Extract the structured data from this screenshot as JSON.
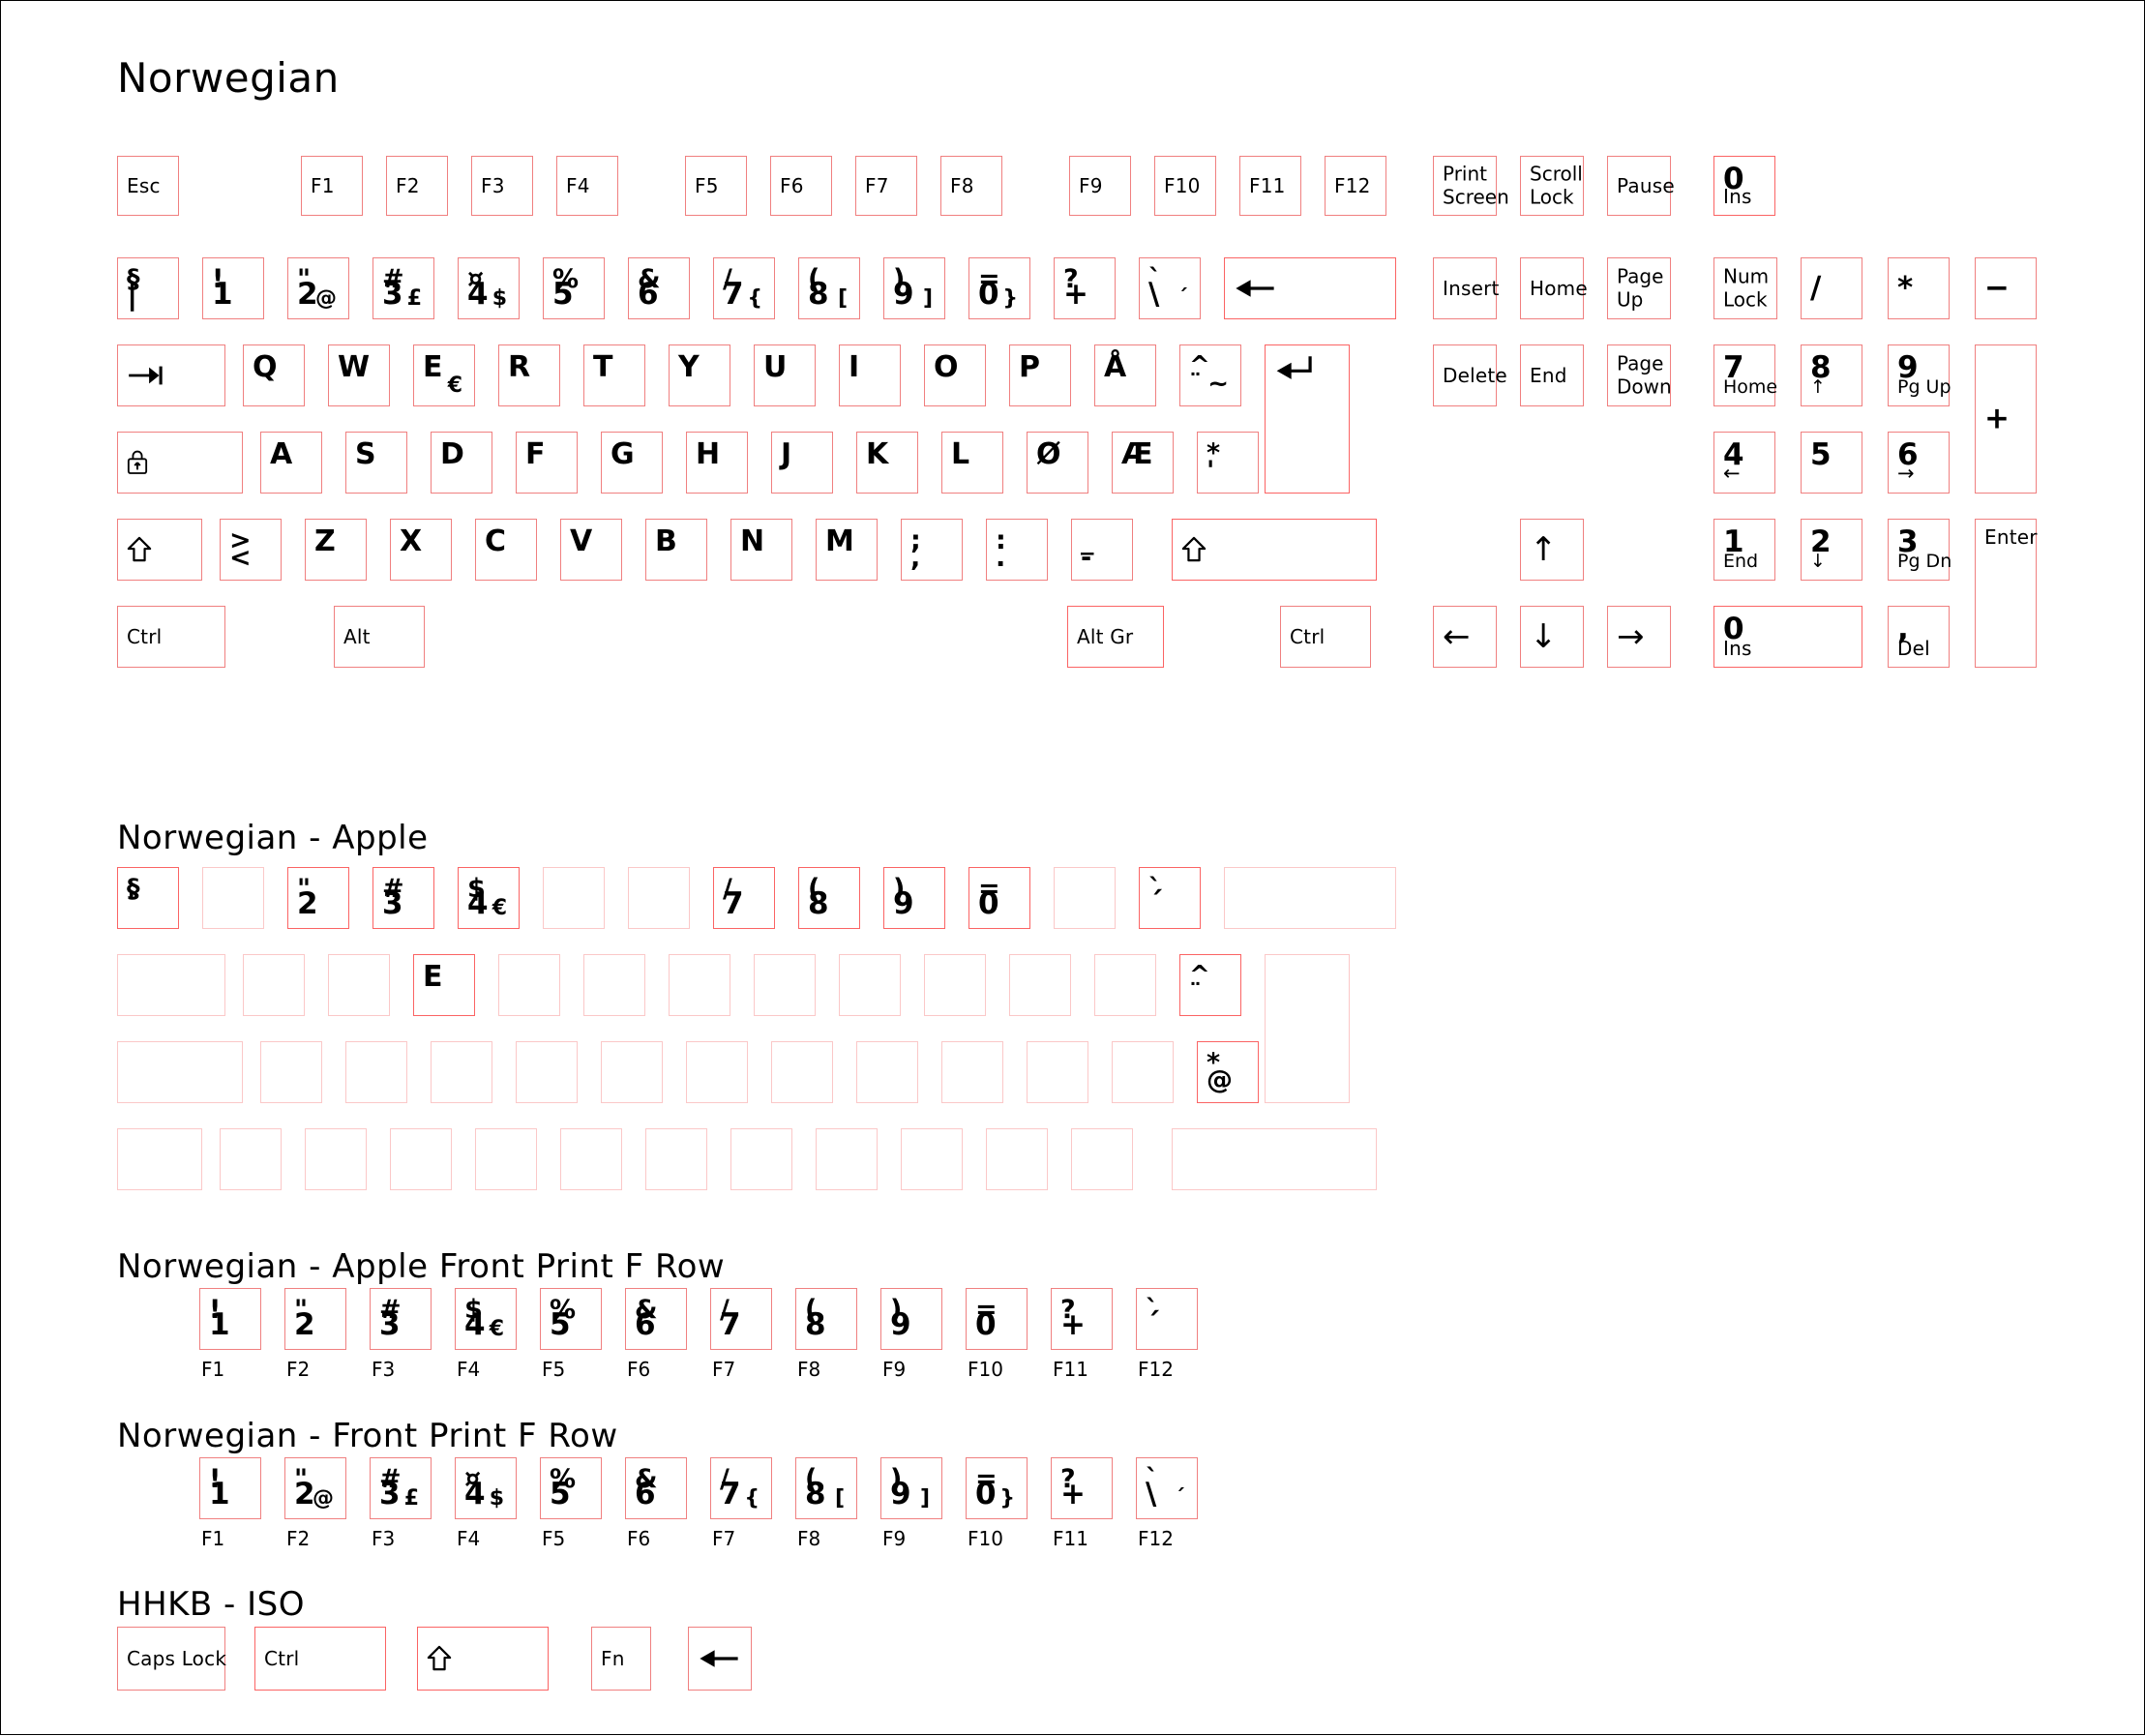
{
  "page": {
    "title": "Norwegian",
    "accent_color": "#f08080",
    "accent_strong": "#fb6464",
    "accent_faint": "#fbc8c8",
    "background": "#ffffff",
    "text_color": "#000000"
  },
  "sections": [
    {
      "id": "main",
      "title": "Norwegian"
    },
    {
      "id": "apple",
      "title": "Norwegian - Apple"
    },
    {
      "id": "apple_fp",
      "title": "Norwegian - Apple Front Print F Row"
    },
    {
      "id": "front_print",
      "title": "Norwegian - Front Print F Row"
    },
    {
      "id": "hhkb",
      "title": "HHKB - ISO"
    }
  ],
  "main": {
    "fn_row": [
      {
        "name": "esc",
        "label": "Esc"
      },
      {
        "name": "f1",
        "label": "F1"
      },
      {
        "name": "f2",
        "label": "F2"
      },
      {
        "name": "f3",
        "label": "F3"
      },
      {
        "name": "f4",
        "label": "F4"
      },
      {
        "name": "f5",
        "label": "F5"
      },
      {
        "name": "f6",
        "label": "F6"
      },
      {
        "name": "f7",
        "label": "F7"
      },
      {
        "name": "f8",
        "label": "F8"
      },
      {
        "name": "f9",
        "label": "F9"
      },
      {
        "name": "f10",
        "label": "F10"
      },
      {
        "name": "f11",
        "label": "F11"
      },
      {
        "name": "f12",
        "label": "F12"
      }
    ],
    "sys_row": [
      {
        "name": "print-screen",
        "line1": "Print",
        "line2": "Screen"
      },
      {
        "name": "scroll-lock",
        "line1": "Scroll",
        "line2": "Lock"
      },
      {
        "name": "pause",
        "line1": "Pause",
        "line2": ""
      },
      {
        "name": "numpad-0-ins-top",
        "top": "0",
        "bottom": "Ins"
      }
    ],
    "number_row": [
      {
        "name": "section-key",
        "tl": "§",
        "bl": "|",
        "br": ""
      },
      {
        "name": "key-1",
        "tl": "!",
        "bl": "1",
        "br": ""
      },
      {
        "name": "key-2",
        "tl": "\"",
        "bl": "2",
        "br": "@"
      },
      {
        "name": "key-3",
        "tl": "#",
        "bl": "3",
        "br": "£"
      },
      {
        "name": "key-4",
        "tl": "¤",
        "bl": "4",
        "br": "$"
      },
      {
        "name": "key-5",
        "tl": "%",
        "bl": "5",
        "br": ""
      },
      {
        "name": "key-6",
        "tl": "&",
        "bl": "6",
        "br": ""
      },
      {
        "name": "key-7",
        "tl": "/",
        "bl": "7",
        "br": "{"
      },
      {
        "name": "key-8",
        "tl": "(",
        "bl": "8",
        "br": "["
      },
      {
        "name": "key-9",
        "tl": ")",
        "bl": "9",
        "br": "]"
      },
      {
        "name": "key-0",
        "tl": "=",
        "bl": "0",
        "br": "}"
      },
      {
        "name": "key-plus",
        "tl": "?",
        "bl": "+",
        "br": ""
      },
      {
        "name": "key-backslash",
        "tl": "`",
        "bl": "\\",
        "br": "´"
      },
      {
        "name": "backspace",
        "icon": "←"
      }
    ],
    "nav_row_1": [
      {
        "name": "insert",
        "label": "Insert"
      },
      {
        "name": "home",
        "label": "Home"
      },
      {
        "name": "page-up",
        "line1": "Page",
        "line2": "Up"
      }
    ],
    "numpad_row_1": [
      {
        "name": "num-lock",
        "line1": "Num",
        "line2": "Lock"
      },
      {
        "name": "numpad-divide",
        "label": "/"
      },
      {
        "name": "numpad-multiply",
        "label": "*"
      },
      {
        "name": "numpad-minus",
        "label": "−"
      }
    ],
    "q_row": [
      {
        "name": "tab",
        "icon": "⇥"
      },
      {
        "name": "key-q",
        "label": "Q"
      },
      {
        "name": "key-w",
        "label": "W"
      },
      {
        "name": "key-e",
        "label": "E",
        "br": "€"
      },
      {
        "name": "key-r",
        "label": "R"
      },
      {
        "name": "key-t",
        "label": "T"
      },
      {
        "name": "key-y",
        "label": "Y"
      },
      {
        "name": "key-u",
        "label": "U"
      },
      {
        "name": "key-i",
        "label": "I"
      },
      {
        "name": "key-o",
        "label": "O"
      },
      {
        "name": "key-p",
        "label": "P"
      },
      {
        "name": "key-aring",
        "label": "Å"
      },
      {
        "name": "key-dead-diaeresis",
        "tl": "^",
        "bl": "¨",
        "br": "~"
      },
      {
        "name": "enter",
        "icon": "↵"
      }
    ],
    "nav_row_2": [
      {
        "name": "delete",
        "label": "Delete"
      },
      {
        "name": "end",
        "label": "End"
      },
      {
        "name": "page-down",
        "line1": "Page",
        "line2": "Down"
      }
    ],
    "numpad_row_2": [
      {
        "name": "numpad-7",
        "top": "7",
        "bottom": "Home"
      },
      {
        "name": "numpad-8",
        "top": "8",
        "bottom": "↑"
      },
      {
        "name": "numpad-9",
        "top": "9",
        "bottom": "Pg Up"
      },
      {
        "name": "numpad-plus",
        "label": "+"
      }
    ],
    "a_row": [
      {
        "name": "caps-lock",
        "icon": "lock"
      },
      {
        "name": "key-a",
        "label": "A"
      },
      {
        "name": "key-s",
        "label": "S"
      },
      {
        "name": "key-d",
        "label": "D"
      },
      {
        "name": "key-f",
        "label": "F"
      },
      {
        "name": "key-g",
        "label": "G"
      },
      {
        "name": "key-h",
        "label": "H"
      },
      {
        "name": "key-j",
        "label": "J"
      },
      {
        "name": "key-k",
        "label": "K"
      },
      {
        "name": "key-l",
        "label": "L"
      },
      {
        "name": "key-oslash",
        "label": "Ø"
      },
      {
        "name": "key-ae",
        "label": "Æ"
      },
      {
        "name": "key-apostrophe",
        "tl": "*",
        "bl": "'"
      }
    ],
    "numpad_row_3": [
      {
        "name": "numpad-4",
        "top": "4",
        "bottom": "←"
      },
      {
        "name": "numpad-5",
        "top": "5",
        "bottom": ""
      },
      {
        "name": "numpad-6",
        "top": "6",
        "bottom": "→"
      }
    ],
    "z_row": [
      {
        "name": "left-shift",
        "icon": "⇧"
      },
      {
        "name": "key-less-greater",
        "tl": ">",
        "bl": "<"
      },
      {
        "name": "key-z",
        "label": "Z"
      },
      {
        "name": "key-x",
        "label": "X"
      },
      {
        "name": "key-c",
        "label": "C"
      },
      {
        "name": "key-v",
        "label": "V"
      },
      {
        "name": "key-b",
        "label": "B"
      },
      {
        "name": "key-n",
        "label": "N"
      },
      {
        "name": "key-m",
        "label": "M"
      },
      {
        "name": "key-comma",
        "tl": ";",
        "bl": ","
      },
      {
        "name": "key-period",
        "tl": ":",
        "bl": "."
      },
      {
        "name": "key-dash",
        "tl": "_",
        "bl": "-"
      },
      {
        "name": "right-shift",
        "icon": "⇧"
      }
    ],
    "arrow_up": {
      "name": "arrow-up",
      "icon": "↑"
    },
    "numpad_row_4": [
      {
        "name": "numpad-1",
        "top": "1",
        "bottom": "End"
      },
      {
        "name": "numpad-2",
        "top": "2",
        "bottom": "↓"
      },
      {
        "name": "numpad-3",
        "top": "3",
        "bottom": "Pg Dn"
      },
      {
        "name": "numpad-enter",
        "label": "Enter"
      }
    ],
    "bottom_row": [
      {
        "name": "left-ctrl",
        "label": "Ctrl"
      },
      {
        "name": "left-alt",
        "label": "Alt"
      },
      {
        "name": "alt-gr",
        "label": "Alt Gr"
      },
      {
        "name": "right-ctrl",
        "label": "Ctrl"
      }
    ],
    "arrows": [
      {
        "name": "arrow-left",
        "icon": "←"
      },
      {
        "name": "arrow-down",
        "icon": "↓"
      },
      {
        "name": "arrow-right",
        "icon": "→"
      }
    ],
    "numpad_row_5": [
      {
        "name": "numpad-0",
        "top": "0",
        "bottom": "Ins"
      },
      {
        "name": "numpad-decimal",
        "top": ",",
        "bottom": "Del"
      }
    ]
  },
  "apple": {
    "number_row": [
      {
        "name": "apple-section-key",
        "tl": "§",
        "bl": "'",
        "filled": true
      },
      {
        "name": "apple-key-1",
        "filled": false
      },
      {
        "name": "apple-key-2",
        "tl": "\"",
        "bl": "2",
        "filled": true
      },
      {
        "name": "apple-key-3",
        "tl": "#",
        "bl": "3",
        "filled": true
      },
      {
        "name": "apple-key-4",
        "tl": "$",
        "bl": "4",
        "br": "€",
        "filled": true
      },
      {
        "name": "apple-key-5",
        "filled": false
      },
      {
        "name": "apple-key-6",
        "filled": false
      },
      {
        "name": "apple-key-7",
        "tl": "/",
        "bl": "7",
        "filled": true
      },
      {
        "name": "apple-key-8",
        "tl": "(",
        "bl": "8",
        "filled": true
      },
      {
        "name": "apple-key-9",
        "tl": ")",
        "bl": "9",
        "filled": true
      },
      {
        "name": "apple-key-0",
        "tl": "=",
        "bl": "0",
        "filled": true
      },
      {
        "name": "apple-key-plus",
        "filled": false
      },
      {
        "name": "apple-key-backslash",
        "tl": "`",
        "bl": "´",
        "filled": true
      },
      {
        "name": "apple-backspace",
        "filled": false
      }
    ],
    "q_row": [
      {
        "name": "apple-tab",
        "filled": false
      },
      {
        "name": "apple-key-q",
        "filled": false
      },
      {
        "name": "apple-key-w",
        "filled": false
      },
      {
        "name": "apple-key-e",
        "label": "E",
        "filled": true
      },
      {
        "name": "apple-key-r",
        "filled": false
      },
      {
        "name": "apple-key-t",
        "filled": false
      },
      {
        "name": "apple-key-y",
        "filled": false
      },
      {
        "name": "apple-key-u",
        "filled": false
      },
      {
        "name": "apple-key-i",
        "filled": false
      },
      {
        "name": "apple-key-o",
        "filled": false
      },
      {
        "name": "apple-key-p",
        "filled": false
      },
      {
        "name": "apple-key-aring",
        "filled": false
      },
      {
        "name": "apple-key-dead",
        "tl": "^",
        "bl": "¨",
        "filled": true
      },
      {
        "name": "apple-enter",
        "filled": false
      }
    ],
    "a_row": [
      {
        "name": "apple-caps-lock",
        "filled": false
      },
      {
        "name": "apple-key-a",
        "filled": false
      },
      {
        "name": "apple-key-s",
        "filled": false
      },
      {
        "name": "apple-key-d",
        "filled": false
      },
      {
        "name": "apple-key-f",
        "filled": false
      },
      {
        "name": "apple-key-g",
        "filled": false
      },
      {
        "name": "apple-key-h",
        "filled": false
      },
      {
        "name": "apple-key-j",
        "filled": false
      },
      {
        "name": "apple-key-k",
        "filled": false
      },
      {
        "name": "apple-key-l",
        "filled": false
      },
      {
        "name": "apple-key-oslash",
        "filled": false
      },
      {
        "name": "apple-key-ae",
        "filled": false
      },
      {
        "name": "apple-key-apostrophe",
        "tl": "*",
        "bl": "@",
        "filled": true
      }
    ],
    "z_row": [
      {
        "name": "apple-left-shift",
        "filled": false
      },
      {
        "name": "apple-key-less-greater",
        "filled": false
      },
      {
        "name": "apple-key-z",
        "filled": false
      },
      {
        "name": "apple-key-x",
        "filled": false
      },
      {
        "name": "apple-key-c",
        "filled": false
      },
      {
        "name": "apple-key-v",
        "filled": false
      },
      {
        "name": "apple-key-b",
        "filled": false
      },
      {
        "name": "apple-key-n",
        "filled": false
      },
      {
        "name": "apple-key-m",
        "filled": false
      },
      {
        "name": "apple-key-comma",
        "filled": false
      },
      {
        "name": "apple-key-period",
        "filled": false
      },
      {
        "name": "apple-key-dash",
        "filled": false
      },
      {
        "name": "apple-right-shift",
        "filled": false
      }
    ]
  },
  "apple_front_print": {
    "keys": [
      {
        "name": "afp-f1",
        "tl": "!",
        "bl": "1",
        "br": "",
        "fn": "F1"
      },
      {
        "name": "afp-f2",
        "tl": "\"",
        "bl": "2",
        "br": "",
        "fn": "F2"
      },
      {
        "name": "afp-f3",
        "tl": "#",
        "bl": "3",
        "br": "",
        "fn": "F3"
      },
      {
        "name": "afp-f4",
        "tl": "$",
        "bl": "4",
        "br": "€",
        "fn": "F4"
      },
      {
        "name": "afp-f5",
        "tl": "%",
        "bl": "5",
        "br": "",
        "fn": "F5"
      },
      {
        "name": "afp-f6",
        "tl": "&",
        "bl": "6",
        "br": "",
        "fn": "F6"
      },
      {
        "name": "afp-f7",
        "tl": "/",
        "bl": "7",
        "br": "",
        "fn": "F7"
      },
      {
        "name": "afp-f8",
        "tl": "(",
        "bl": "8",
        "br": "",
        "fn": "F8"
      },
      {
        "name": "afp-f9",
        "tl": ")",
        "bl": "9",
        "br": "",
        "fn": "F9"
      },
      {
        "name": "afp-f10",
        "tl": "=",
        "bl": "0",
        "br": "",
        "fn": "F10"
      },
      {
        "name": "afp-f11",
        "tl": "?",
        "bl": "+",
        "br": "",
        "fn": "F11"
      },
      {
        "name": "afp-f12",
        "tl": "`",
        "bl": "´",
        "br": "",
        "fn": "F12"
      }
    ]
  },
  "front_print": {
    "keys": [
      {
        "name": "fp-f1",
        "tl": "!",
        "bl": "1",
        "br": "",
        "fn": "F1"
      },
      {
        "name": "fp-f2",
        "tl": "\"",
        "bl": "2",
        "br": "@",
        "fn": "F2"
      },
      {
        "name": "fp-f3",
        "tl": "#",
        "bl": "3",
        "br": "£",
        "fn": "F3"
      },
      {
        "name": "fp-f4",
        "tl": "¤",
        "bl": "4",
        "br": "$",
        "fn": "F4"
      },
      {
        "name": "fp-f5",
        "tl": "%",
        "bl": "5",
        "br": "",
        "fn": "F5"
      },
      {
        "name": "fp-f6",
        "tl": "&",
        "bl": "6",
        "br": "",
        "fn": "F6"
      },
      {
        "name": "fp-f7",
        "tl": "/",
        "bl": "7",
        "br": "{",
        "fn": "F7"
      },
      {
        "name": "fp-f8",
        "tl": "(",
        "bl": "8",
        "br": "[",
        "fn": "F8"
      },
      {
        "name": "fp-f9",
        "tl": ")",
        "bl": "9",
        "br": "]",
        "fn": "F9"
      },
      {
        "name": "fp-f10",
        "tl": "=",
        "bl": "0",
        "br": "}",
        "fn": "F10"
      },
      {
        "name": "fp-f11",
        "tl": "?",
        "bl": "+",
        "br": "",
        "fn": "F11"
      },
      {
        "name": "fp-f12",
        "tl": "`",
        "bl": "\\",
        "br": "´",
        "fn": "F12"
      }
    ]
  },
  "hhkb": {
    "keys": [
      {
        "name": "hhkb-caps-lock",
        "label": "Caps Lock"
      },
      {
        "name": "hhkb-ctrl",
        "label": "Ctrl"
      },
      {
        "name": "hhkb-shift",
        "icon": "⇧"
      },
      {
        "name": "hhkb-fn",
        "label": "Fn"
      },
      {
        "name": "hhkb-backspace",
        "icon": "←"
      }
    ]
  }
}
